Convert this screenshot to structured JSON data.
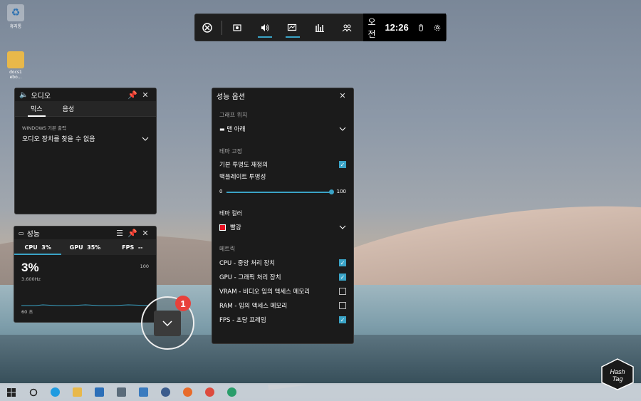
{
  "desktop": {
    "icons": [
      {
        "label": "휴지통",
        "icon": "recycle-bin-icon"
      },
      {
        "label": "docs1 ebo...",
        "icon": "folder-icon"
      }
    ]
  },
  "gamebar": {
    "buttons": [
      "xbox-icon",
      "capture-icon",
      "audio-icon",
      "performance-icon",
      "resources-icon",
      "social-icon"
    ],
    "time_ampm": "오전",
    "time": "12:26"
  },
  "audio_widget": {
    "title": "오디오",
    "tabs": [
      "믹스",
      "음성"
    ],
    "section_label": "WINDOWS 기본 출력",
    "device_text": "오디오 장치를 찾을 수 없음"
  },
  "perf_widget": {
    "title": "성능",
    "tabs": [
      {
        "label": "CPU",
        "value": "3%"
      },
      {
        "label": "GPU",
        "value": "35%"
      },
      {
        "label": "FPS",
        "value": "--"
      }
    ],
    "big_value": "3%",
    "freq": "3.600Hz",
    "y_max": "100",
    "duration": "60 초"
  },
  "options_panel": {
    "title": "성능 옵션",
    "graph_position_label": "그래프 위치",
    "graph_position_value": "맨 아래",
    "theme_fix_label": "테마 고정",
    "reset_transparency": "기본 투명도 재정의",
    "backplate_transparency": "백플레이트 투명성",
    "slider_min": "0",
    "slider_max": "100",
    "slider_value": 100,
    "theme_color_label": "테마 컬러",
    "theme_color_value": "빨강",
    "theme_color_hex": "#e81123",
    "metrics_label": "메트릭",
    "metrics": [
      {
        "label": "CPU - 중앙 처리 장치",
        "checked": true
      },
      {
        "label": "GPU - 그래픽 처리 장치",
        "checked": true
      },
      {
        "label": "VRAM - 비디오 임의 액세스 메모리",
        "checked": false
      },
      {
        "label": "RAM - 임의 액세스 메모리",
        "checked": false
      },
      {
        "label": "FPS - 초당 프레임",
        "checked": true
      }
    ]
  },
  "annotation": {
    "badge": "1"
  },
  "logo": {
    "line1": "Hash",
    "line2": "Tag"
  },
  "colors": {
    "accent": "#3aa3c6",
    "badge": "#e8413b"
  }
}
